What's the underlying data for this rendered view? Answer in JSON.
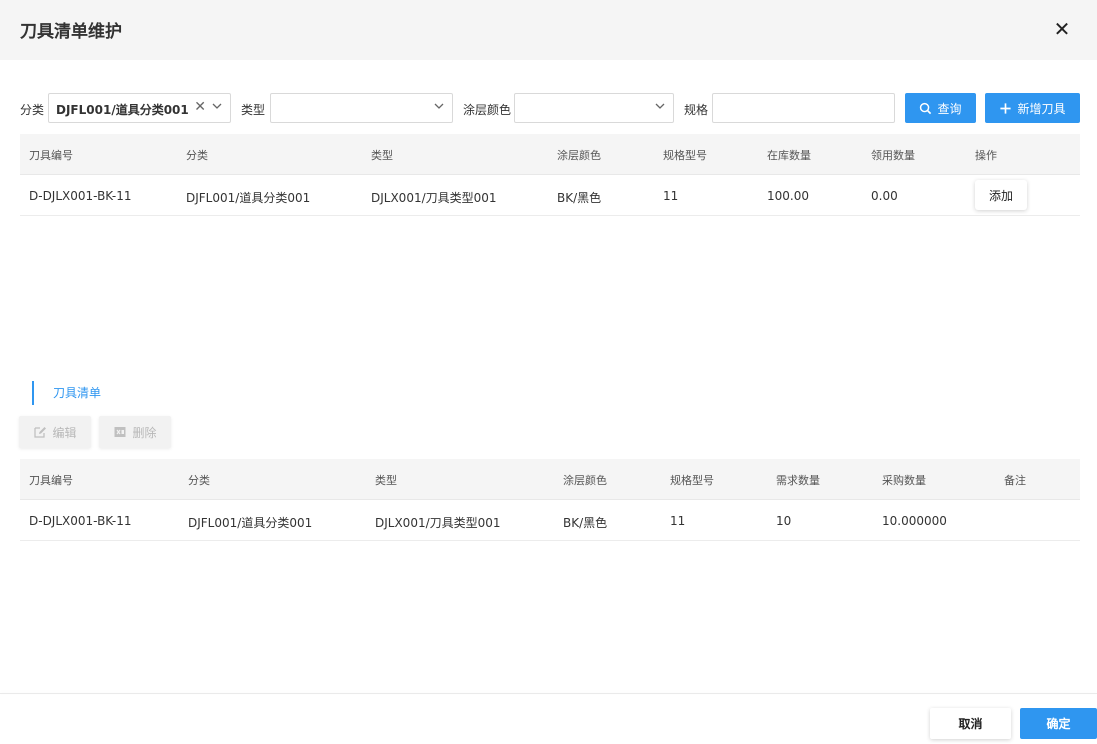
{
  "dialog": {
    "title": "刀具清单维护",
    "close_icon": "close-icon"
  },
  "filters": {
    "category_label": "分类",
    "category_value": "DJFL001/道具分类001",
    "type_label": "类型",
    "type_value": "",
    "coating_label": "涂层颜色",
    "coating_value": "",
    "spec_label": "规格",
    "spec_value": "",
    "query_label": "查询",
    "add_tool_label": "新增刀具",
    "accent": "#2f96f0"
  },
  "search_table": {
    "headers": [
      "刀具编号",
      "分类",
      "类型",
      "涂层颜色",
      "规格型号",
      "在库数量",
      "领用数量",
      "操作"
    ],
    "rows": [
      {
        "code": "D-DJLX001-BK-11",
        "category": "DJFL001/道具分类001",
        "type": "DJLX001/刀具类型001",
        "coating": "BK/黑色",
        "spec": "11",
        "stock": "100.00",
        "used": "0.00",
        "action": "添加"
      }
    ]
  },
  "list_section": {
    "title": "刀具清单",
    "edit_label": "编辑",
    "delete_label": "删除",
    "headers": [
      "刀具编号",
      "分类",
      "类型",
      "涂层颜色",
      "规格型号",
      "需求数量",
      "采购数量",
      "备注"
    ],
    "rows": [
      {
        "code": "D-DJLX001-BK-11",
        "category": "DJFL001/道具分类001",
        "type": "DJLX001/刀具类型001",
        "coating": "BK/黑色",
        "spec": "11",
        "demand": "10",
        "purchase": "10.000000",
        "note": ""
      }
    ]
  },
  "footer": {
    "cancel_label": "取消",
    "ok_label": "确定"
  }
}
